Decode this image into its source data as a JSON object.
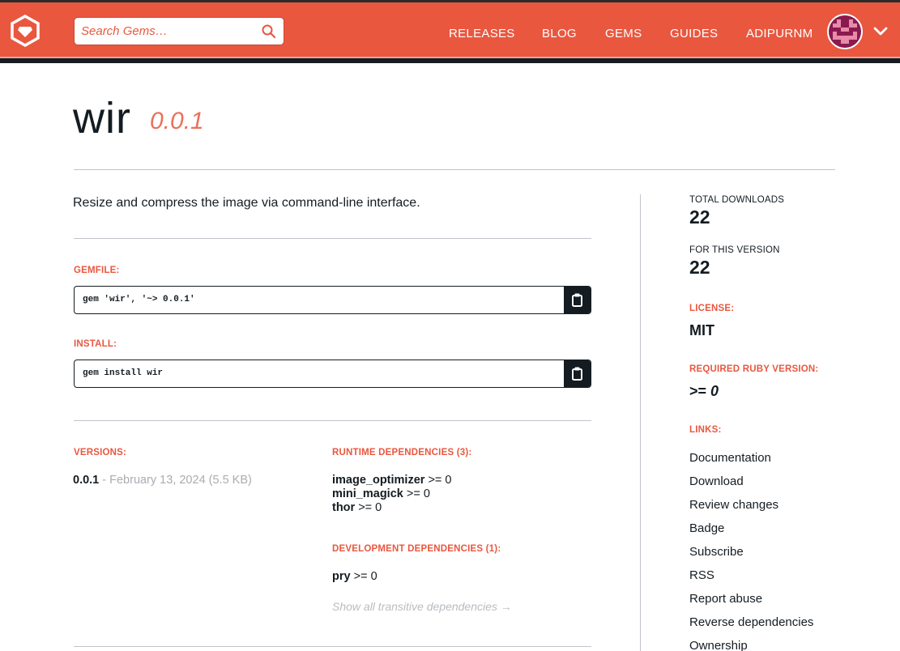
{
  "header": {
    "search_placeholder": "Search Gems…",
    "nav": [
      "RELEASES",
      "BLOG",
      "GEMS",
      "GUIDES",
      "ADIPURNM"
    ]
  },
  "gem": {
    "name": "wir",
    "version": "0.0.1",
    "description": "Resize and compress the image via command-line interface."
  },
  "gemfile": {
    "label": "GEMFILE:",
    "code": "gem 'wir', '~> 0.0.1'"
  },
  "install": {
    "label": "INSTALL:",
    "code": "gem install wir"
  },
  "versions": {
    "label": "VERSIONS:",
    "number": "0.0.1",
    "meta": " - February 13, 2024 (5.5 KB)"
  },
  "runtime_dependencies": {
    "label": "RUNTIME DEPENDENCIES (3):",
    "items": [
      {
        "name": "image_optimizer",
        "req": " >= 0"
      },
      {
        "name": "mini_magick",
        "req": " >= 0"
      },
      {
        "name": "thor",
        "req": " >= 0"
      }
    ]
  },
  "development_dependencies": {
    "label": "DEVELOPMENT DEPENDENCIES (1):",
    "items": [
      {
        "name": "pry",
        "req": " >= 0"
      }
    ]
  },
  "transitive_link": "Show all transitive dependencies →",
  "sidebar": {
    "total_downloads_label": "TOTAL DOWNLOADS",
    "total_downloads": "22",
    "version_downloads_label": "FOR THIS VERSION",
    "version_downloads": "22",
    "license_label": "LICENSE:",
    "license": "MIT",
    "ruby_version_label": "REQUIRED RUBY VERSION:",
    "ruby_version_op": ">=",
    "ruby_version_num": "0",
    "links_label": "LINKS:",
    "links": [
      "Documentation",
      "Download",
      "Review changes",
      "Badge",
      "Subscribe",
      "RSS",
      "Report abuse",
      "Reverse dependencies",
      "Ownership"
    ]
  },
  "colors": {
    "brand": "#e9573f",
    "dark": "#141c22",
    "muted": "#a8acb2"
  }
}
